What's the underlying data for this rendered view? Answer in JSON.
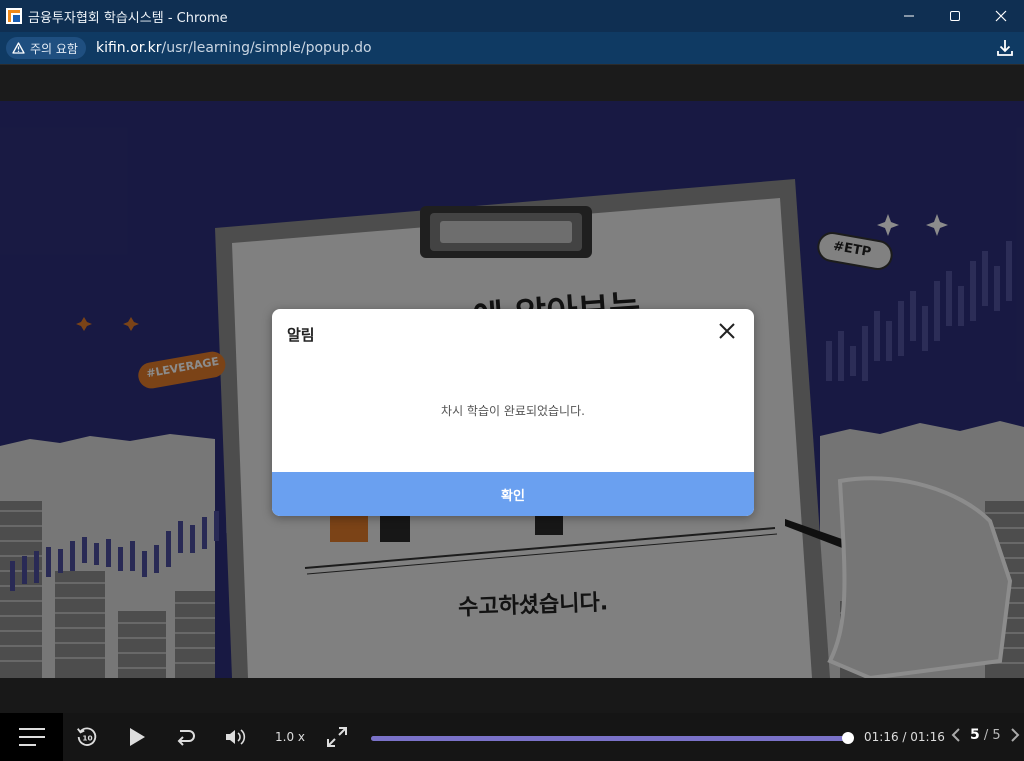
{
  "window": {
    "title": "금융투자협회 학습시스템 - Chrome"
  },
  "address": {
    "warning": "주의 요함",
    "url_host": "kifin.or.kr",
    "url_path": "/usr/learning/simple/popup.do"
  },
  "slide": {
    "heading_partial": "에 알아보는",
    "tag_leverage": "#LEVERAGE",
    "tag_etp": "#ETP",
    "closing": "수고하셨습니다."
  },
  "dialog": {
    "title": "알림",
    "message": "차시 학습이 완료되었습니다.",
    "ok_label": "확인"
  },
  "player": {
    "speed": "1.0 x",
    "time": "01:16 / 01:16",
    "progress": 1.0,
    "page_current": "5",
    "page_total": "5",
    "page_separator": " / "
  },
  "colors": {
    "titlebar": "#0f2f52",
    "addressbar": "#0f3a63",
    "ok_button": "#6aa0f0",
    "progress": "#7a72c8",
    "slide_bg": "#2d2f7a",
    "accent_orange": "#e07a2a"
  }
}
